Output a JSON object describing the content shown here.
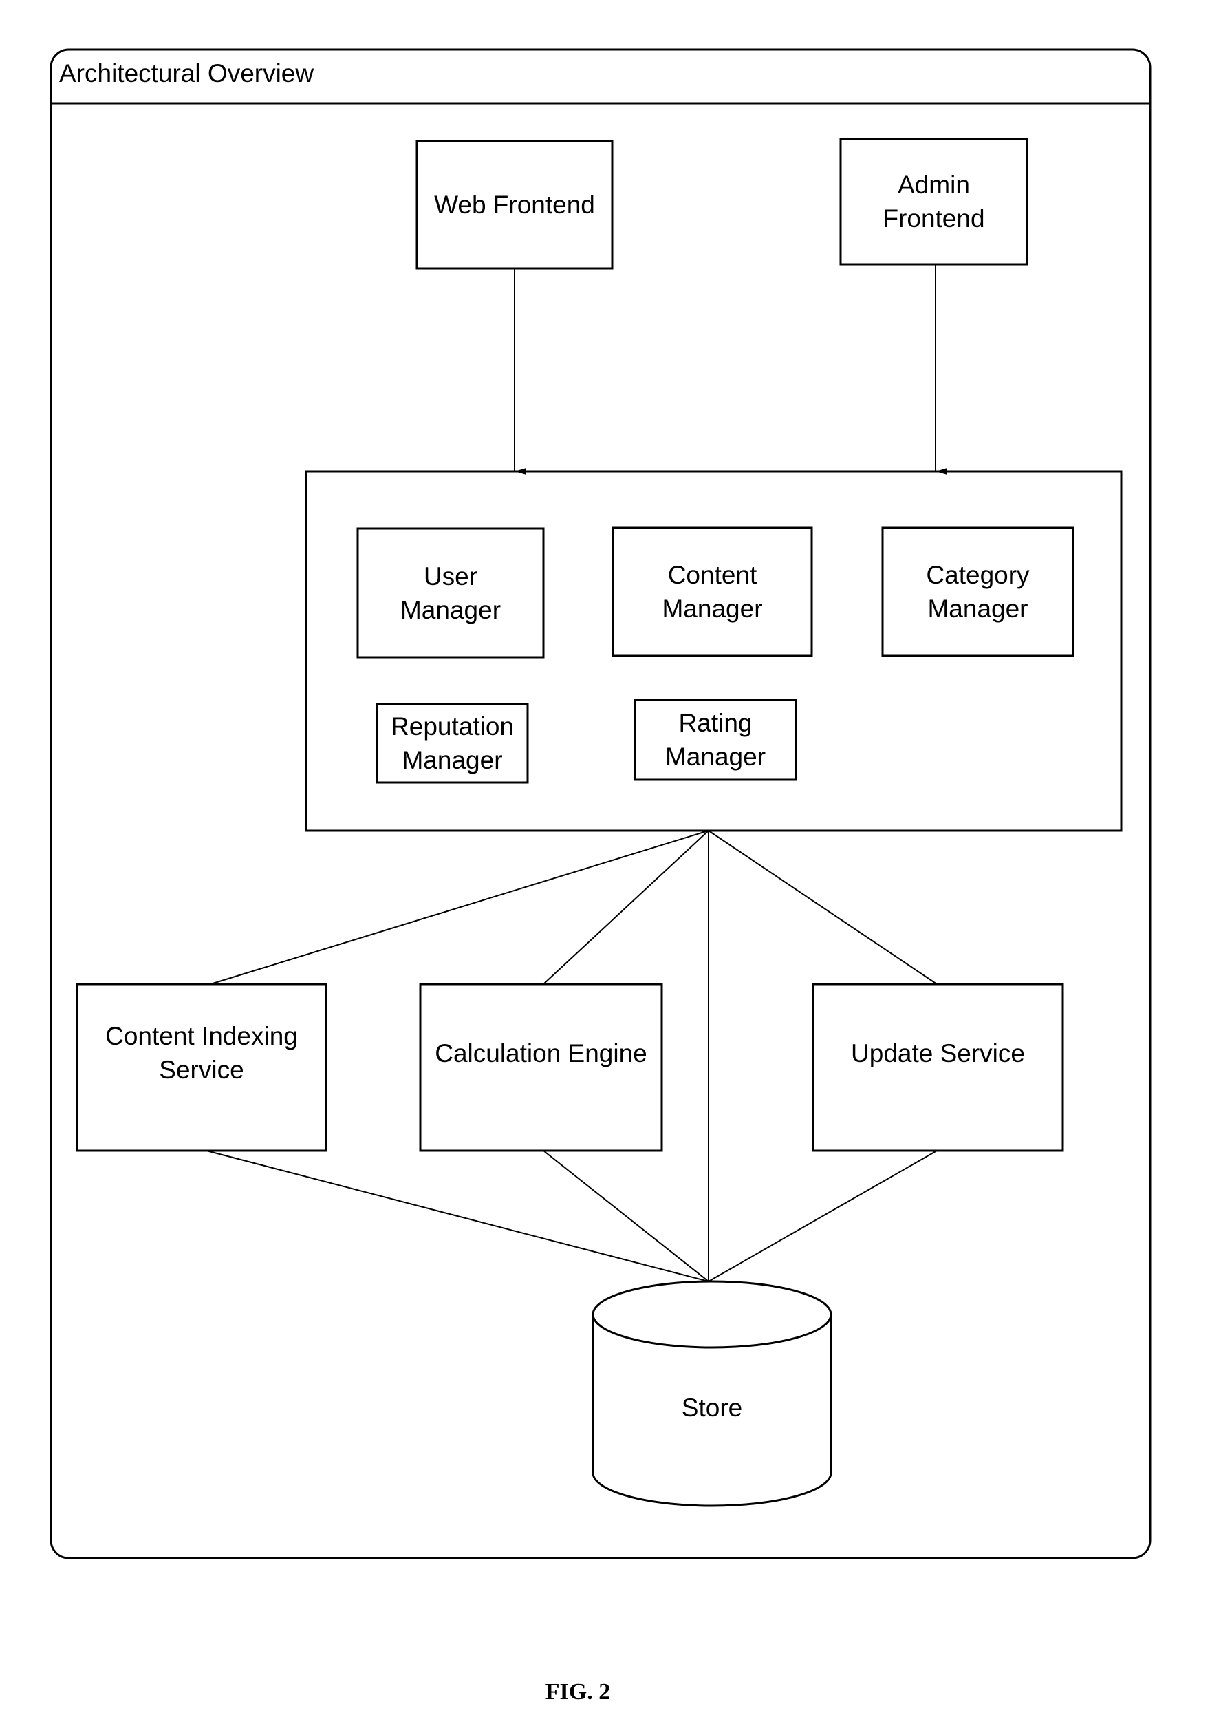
{
  "frame": {
    "title": "Architectural Overview"
  },
  "frontends": [
    {
      "id": "web",
      "label": "Web Frontend"
    },
    {
      "id": "admin",
      "label": "Admin\nFrontend"
    }
  ],
  "managers": [
    {
      "id": "user",
      "label": "User\nManager"
    },
    {
      "id": "content",
      "label": "Content\nManager"
    },
    {
      "id": "category",
      "label": "Category\nManager"
    },
    {
      "id": "reputation",
      "label": "Reputation\nManager"
    },
    {
      "id": "rating",
      "label": "Rating\nManager"
    }
  ],
  "services": [
    {
      "id": "indexing",
      "label": "Content Indexing\nService"
    },
    {
      "id": "calc",
      "label": "Calculation Engine"
    },
    {
      "id": "update",
      "label": "Update Service"
    }
  ],
  "store": {
    "label": "Store"
  },
  "caption": "FIG. 2",
  "edges": [
    {
      "from": "web",
      "to": "managers",
      "arrow": true
    },
    {
      "from": "admin",
      "to": "managers",
      "arrow": true
    },
    {
      "from": "managers",
      "to": "indexing",
      "arrow": false
    },
    {
      "from": "managers",
      "to": "calc",
      "arrow": false
    },
    {
      "from": "managers",
      "to": "store",
      "arrow": false
    },
    {
      "from": "managers",
      "to": "update",
      "arrow": false
    },
    {
      "from": "indexing",
      "to": "store",
      "arrow": false
    },
    {
      "from": "calc",
      "to": "store",
      "arrow": false
    },
    {
      "from": "update",
      "to": "store",
      "arrow": false
    }
  ]
}
